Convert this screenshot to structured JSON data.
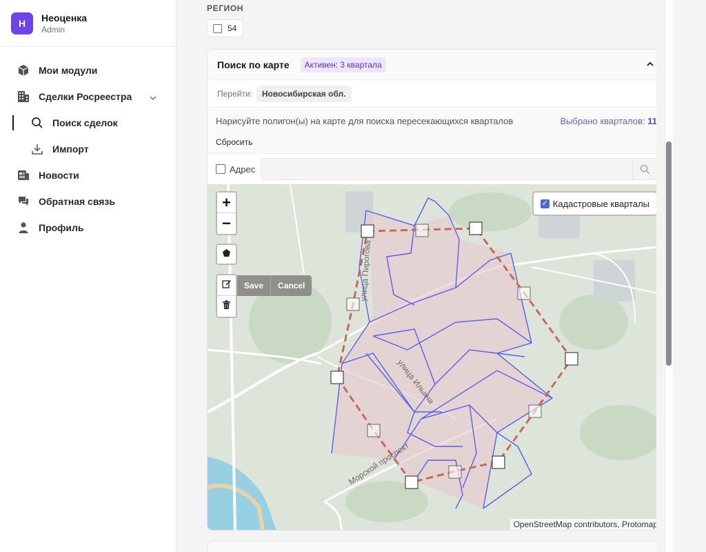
{
  "brand": {
    "initial": "Н",
    "name": "Неоценка",
    "role": "Admin"
  },
  "sidebar": {
    "items": [
      {
        "label": "Мои модули",
        "icon": "box-icon"
      },
      {
        "label": "Сделки Росреестра",
        "icon": "building-icon"
      },
      {
        "label": "Поиск сделок",
        "icon": "search-icon"
      },
      {
        "label": "Импорт",
        "icon": "download-icon"
      },
      {
        "label": "Новости",
        "icon": "newspaper-icon"
      },
      {
        "label": "Обратная связь",
        "icon": "feedback-icon"
      },
      {
        "label": "Профиль",
        "icon": "user-icon"
      }
    ]
  },
  "region": {
    "label": "РЕГИОН",
    "value": "54"
  },
  "map_search": {
    "title": "Поиск по карте",
    "badge": "Активен: 3 квартала",
    "goto_label": "Перейти:",
    "goto_value": "Новосибирская обл.",
    "hint": "Нарисуйте полигон(ы) на карте для поиска пересекающихся кварталов",
    "selected_label": "Выбрано кварталов:",
    "selected_count": "11",
    "reset": "Сбросить",
    "address_label": "Адрес",
    "address_value": ""
  },
  "map": {
    "zoom_in": "+",
    "zoom_out": "−",
    "save": "Save",
    "cancel": "Cancel",
    "layer_label": "Кадастровые кварталы",
    "attribution": "OpenStreetMap contributors, Protomaps",
    "street_labels": [
      "улица Пирогова",
      "улица Ильича",
      "Морской проспект"
    ]
  },
  "colors": {
    "accent": "#6d44e8",
    "badge_text": "#5b34c9",
    "cadastral": "#5b5ee8",
    "draw_polygon": "#c66a55"
  }
}
